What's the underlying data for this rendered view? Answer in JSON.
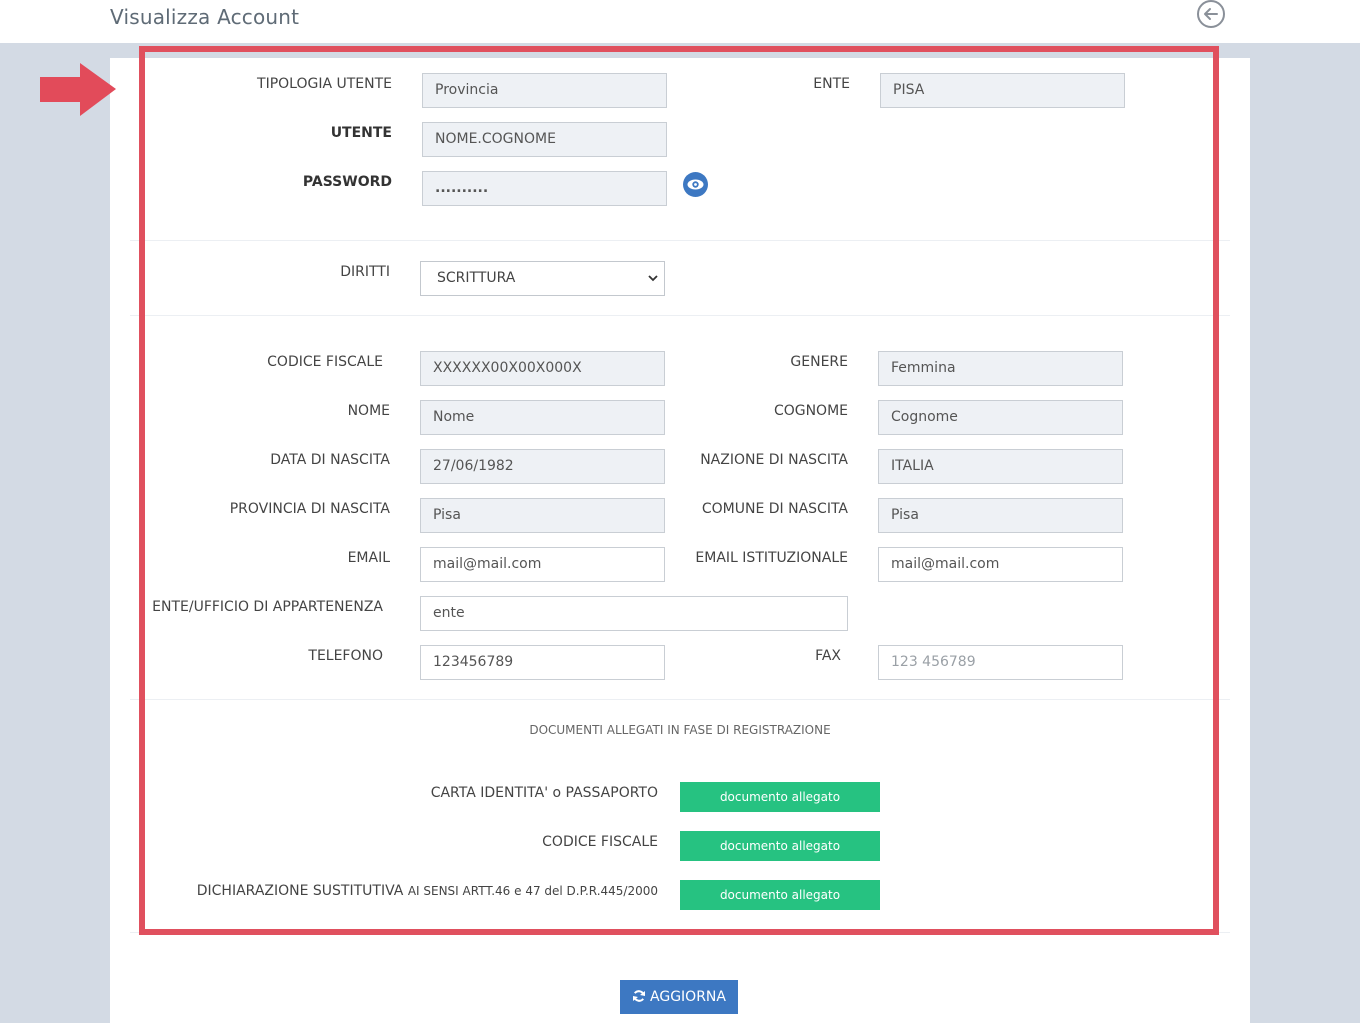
{
  "header": {
    "title": "Visualizza Account",
    "back_icon": "arrow-left-circle-icon"
  },
  "account": {
    "tipologia_label": "TIPOLOGIA UTENTE",
    "tipologia_value": "Provincia",
    "ente_label": "ENTE",
    "ente_value": "PISA",
    "utente_label": "UTENTE",
    "utente_value": "NOME.COGNOME",
    "password_label": "PASSWORD",
    "password_value": "..........",
    "show_password_icon": "eye-icon"
  },
  "rights": {
    "label": "DIRITTI",
    "selected": "SCRITTURA"
  },
  "personal": {
    "cf_label": "CODICE FISCALE",
    "cf_value": "XXXXXX00X00X000X",
    "genere_label": "GENERE",
    "genere_value": "Femmina",
    "nome_label": "NOME",
    "nome_value": "Nome",
    "cognome_label": "COGNOME",
    "cognome_value": "Cognome",
    "data_label": "DATA DI NASCITA",
    "data_value": "27/06/1982",
    "nazione_label": "NAZIONE DI NASCITA",
    "nazione_value": "ITALIA",
    "provincia_label": "PROVINCIA DI NASCITA",
    "provincia_value": "Pisa",
    "comune_label": "COMUNE DI NASCITA",
    "comune_value": "Pisa",
    "email_label": "EMAIL",
    "email_value": "mail@mail.com",
    "email_ist_label": "EMAIL ISTITUZIONALE",
    "email_ist_value": "mail@mail.com",
    "ufficio_label": "ENTE/UFFICIO DI APPARTENENZA",
    "ufficio_value": "ente",
    "telefono_label": "TELEFONO",
    "telefono_value": "123456789",
    "fax_label": "FAX",
    "fax_placeholder": "123 456789"
  },
  "documents": {
    "section_title": "DOCUMENTI ALLEGATI IN FASE DI REGISTRAZIONE",
    "items": [
      {
        "label": "CARTA IDENTITA' o PASSAPORTO",
        "button": "documento allegato"
      },
      {
        "label": "CODICE FISCALE",
        "button": "documento allegato"
      },
      {
        "label": "DICHIARAZIONE SUSTITUTIVA",
        "label_small": "AI SENSI ARTT.46 e 47 del D.P.R.445/2000",
        "button": "documento allegato"
      }
    ]
  },
  "actions": {
    "update_label": "AGGIORNA",
    "update_icon": "refresh-icon"
  },
  "annotation": {
    "arrow_color": "#e24b5a",
    "highlight_color": "#e0505e"
  }
}
